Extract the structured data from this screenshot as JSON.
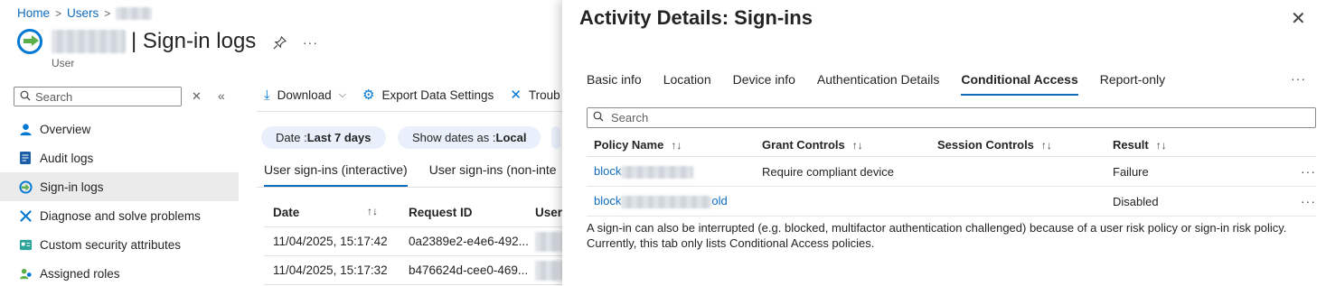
{
  "breadcrumb": {
    "home": "Home",
    "users": "Users"
  },
  "page": {
    "title": "| Sign-in logs",
    "subtitle": "User"
  },
  "left_search": {
    "placeholder": "Search"
  },
  "nav": [
    {
      "label": "Overview",
      "icon": "user-icon"
    },
    {
      "label": "Audit logs",
      "icon": "audit-log-icon"
    },
    {
      "label": "Sign-in logs",
      "icon": "signin-icon",
      "active": true
    },
    {
      "label": "Diagnose and solve problems",
      "icon": "wrench-icon"
    },
    {
      "label": "Custom security attributes",
      "icon": "attributes-icon"
    },
    {
      "label": "Assigned roles",
      "icon": "roles-icon"
    }
  ],
  "toolbar": {
    "download": "Download",
    "export": "Export Data Settings",
    "troubleshoot": "Troub"
  },
  "pills": {
    "date_label": "Date : ",
    "date_value": "Last 7 days",
    "show_label": "Show dates as : ",
    "show_value": "Local"
  },
  "sub_tabs": {
    "interactive": "User sign-ins (interactive)",
    "non_interactive": "User sign-ins (non-inte"
  },
  "grid": {
    "headers": {
      "date": "Date",
      "request_id": "Request ID",
      "user": "User"
    },
    "rows": [
      {
        "date": "11/04/2025, 15:17:42",
        "request_id": "0a2389e2-e4e6-492..."
      },
      {
        "date": "11/04/2025, 15:17:32",
        "request_id": "b476624d-cee0-469..."
      }
    ]
  },
  "pane": {
    "title": "Activity Details: Sign-ins",
    "tabs": [
      "Basic info",
      "Location",
      "Device info",
      "Authentication Details",
      "Conditional Access",
      "Report-only"
    ],
    "selected_tab": "Conditional Access",
    "search_placeholder": "Search",
    "table": {
      "headers": {
        "policy": "Policy Name",
        "grant": "Grant Controls",
        "session": "Session Controls",
        "result": "Result"
      },
      "rows": [
        {
          "policy_prefix": "block",
          "policy_suffix": "",
          "grant": "Require compliant device",
          "session": "",
          "result": "Failure"
        },
        {
          "policy_prefix": "block",
          "policy_suffix": "old",
          "grant": "",
          "session": "",
          "result": "Disabled"
        }
      ]
    },
    "note_line1": "A sign-in can also be interrupted (e.g. blocked, multifactor authentication challenged) because of a user risk policy or sign-in risk policy.",
    "note_line2": "Currently, this tab only lists Conditional Access policies."
  },
  "colors": {
    "accent": "#0f6cbd",
    "pill_bg": "#eaf0fb",
    "active_nav": "#ebebeb"
  }
}
